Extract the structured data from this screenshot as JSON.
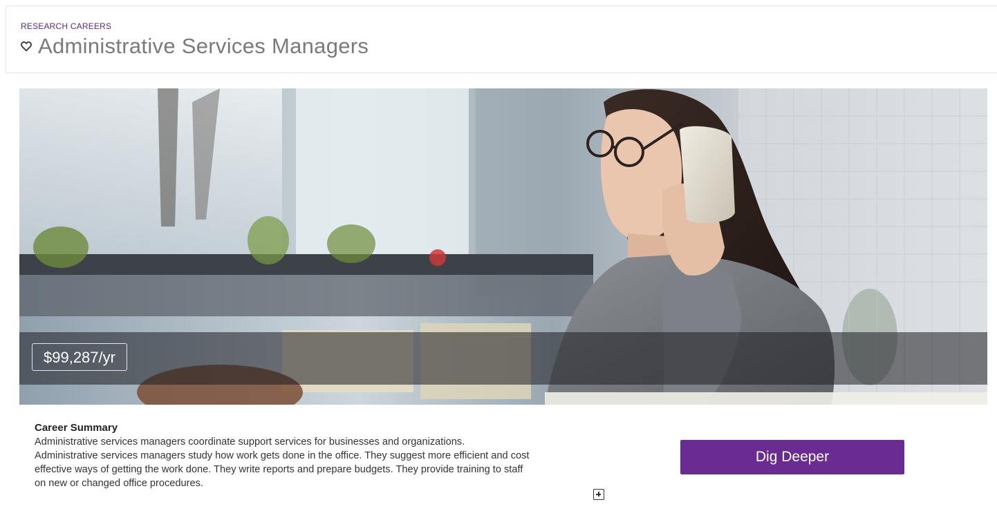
{
  "header": {
    "eyebrow": "RESEARCH CAREERS",
    "title": "Administrative Services Managers",
    "favorite_icon": "heart-outline-icon"
  },
  "hero": {
    "image_description_icon": "photo",
    "salary": "$99,287/yr"
  },
  "summary": {
    "heading": "Career Summary",
    "text_lines": [
      "Administrative services managers coordinate support services for businesses and organizations.",
      "Administrative services managers study how work gets done in the office. They suggest more efficient and cost",
      "effective ways of getting the work done. They write reports and prepare budgets. They provide training to staff",
      "on new or changed office procedures."
    ],
    "expand_icon": "plus-square-icon"
  },
  "actions": {
    "dig_deeper_label": "Dig Deeper"
  },
  "colors": {
    "accent": "#6a2c91",
    "eyebrow": "#5b2a86",
    "title": "#7a7a7a"
  }
}
